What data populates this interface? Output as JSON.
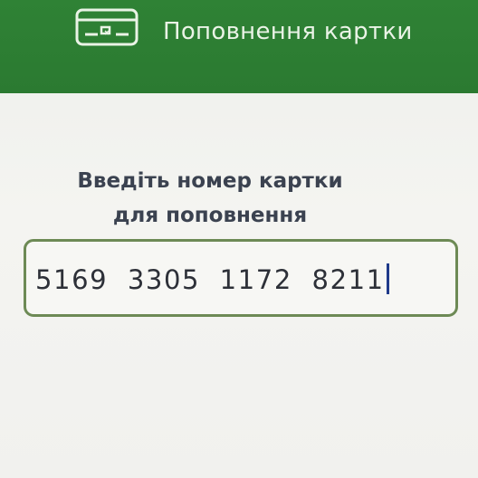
{
  "header": {
    "title": "Поповнення картки",
    "icon": "card-icon",
    "background_color": "#2b7a31"
  },
  "prompt": {
    "line1": "Введіть номер картки",
    "line2": "для поповнення"
  },
  "card_input": {
    "value": "5169  3305  1172  8211",
    "border_color": "#6d8a55",
    "caret_color": "#1f3a8a"
  }
}
